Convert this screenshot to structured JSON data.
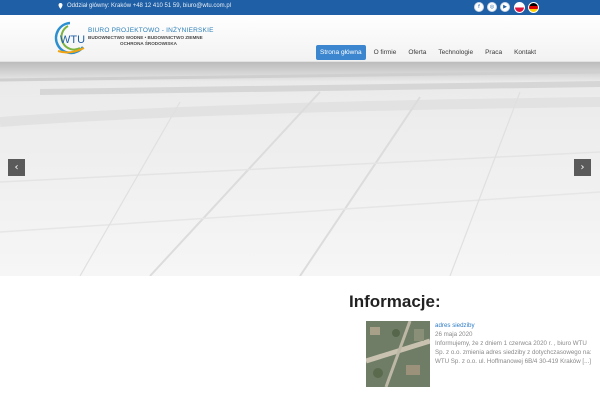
{
  "topbar": {
    "office": "Oddział główny: Kraków +48 12 410 51 59, biuro@wtu.com.pl",
    "social_icons": [
      "facebook-icon",
      "rss-icon",
      "youtube-icon"
    ],
    "social_glyphs": [
      "f",
      "◎",
      "▶"
    ],
    "flags": [
      "pl-flag",
      "de-flag"
    ]
  },
  "header": {
    "logo_text": "WTU",
    "brand_title": "BIURO PROJEKTOWO - INŻYNIERSKIE",
    "brand_sub1": "BUDOWNICTWO WODNE • BUDOWNICTWO ZIEMNE",
    "brand_sub2": "OCHRONA ŚRODOWISKA"
  },
  "nav": {
    "items": [
      "Strona główna",
      "O firmie",
      "Oferta",
      "Technologie",
      "Praca",
      "Kontakt"
    ],
    "active": "Strona główna"
  },
  "slider": {
    "prev": "‹",
    "next": "›"
  },
  "info": {
    "heading": "Informacje:",
    "news": {
      "title": "adres siedziby",
      "date": "26 maja 2020",
      "excerpt": "Informujemy, że z dniem 1 czerwca 2020 r. , biuro WTU Sp. z o.o. zmienia adres siedziby z dotychczasowego na: WTU Sp. z o.o. ul. Hoffmanowej 6B/4 30-419 Kraków [...]"
    }
  },
  "colors": {
    "topbar": "#1f5fa5",
    "accent": "#3b86cf",
    "link": "#2f7cc5"
  }
}
